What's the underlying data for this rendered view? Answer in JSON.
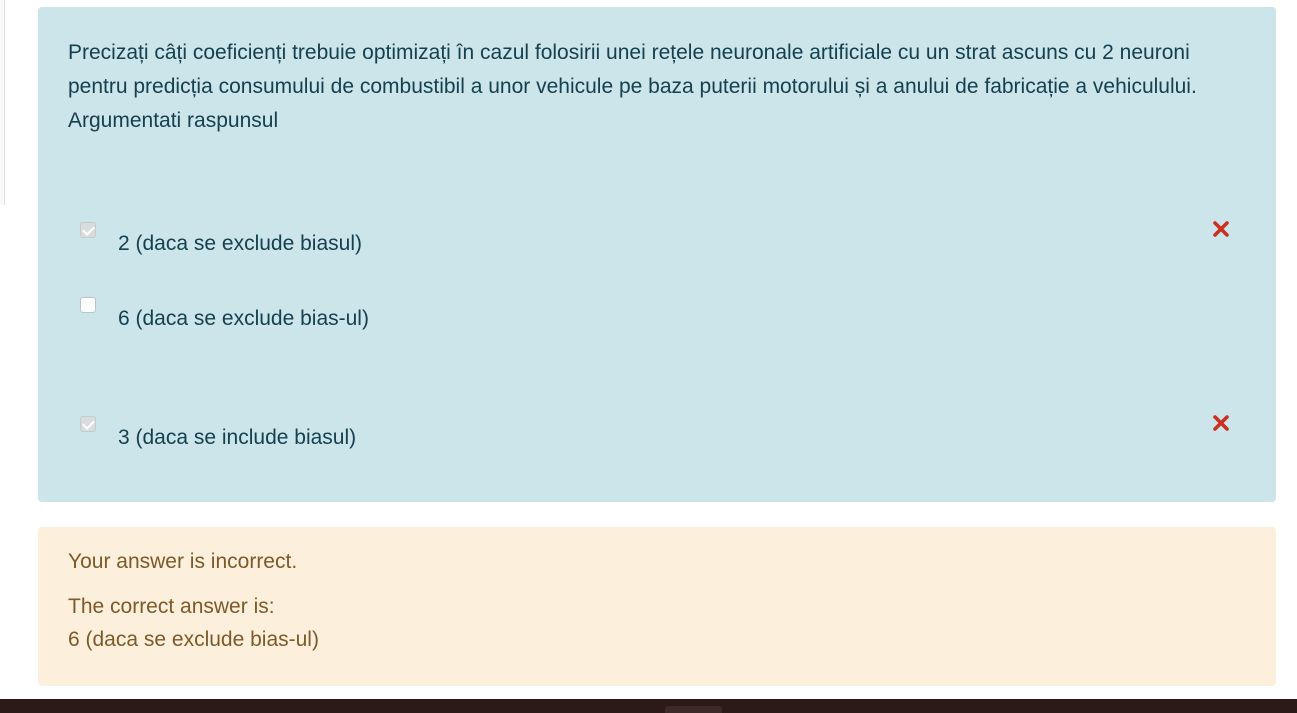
{
  "question": {
    "text": "Precizați câți coeficienți trebuie optimizați în cazul folosirii unei rețele neuronale artificiale cu un strat ascuns cu 2 neuroni pentru predicția consumului de combustibil a unor vehicule pe baza puterii motorului și a anului de fabricație a vehiculului. Argumentati raspunsul",
    "options": [
      {
        "label": "2 (daca se exclude biasul)",
        "checked": true,
        "mark": "incorrect-icon"
      },
      {
        "label": "6 (daca se exclude bias-ul)",
        "checked": false,
        "mark": ""
      },
      {
        "label": "3 (daca se include biasul)",
        "checked": true,
        "mark": "incorrect-icon"
      }
    ]
  },
  "feedback": {
    "status": "Your answer is incorrect.",
    "correct_label": "The correct answer is:",
    "correct_value": "6 (daca se exclude bias-ul)"
  },
  "colors": {
    "question_bg": "#cce5ea",
    "feedback_bg": "#fcefdc",
    "incorrect_mark": "#ca3120"
  }
}
